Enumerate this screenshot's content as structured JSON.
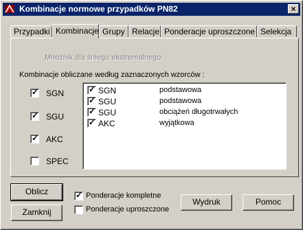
{
  "window": {
    "title": "Kombinacje normowe przypadków PN82",
    "close_label": "×"
  },
  "tabs": [
    {
      "label": "Przypadki"
    },
    {
      "label": "Kombinacje"
    },
    {
      "label": "Grupy"
    },
    {
      "label": "Relacje"
    },
    {
      "label": "Ponderacje uproszczone"
    },
    {
      "label": "Selekcja"
    }
  ],
  "panel": {
    "snow_label": "Mnożnik dla śniegu ekstremalnego:",
    "group_label": "Kombinacje obliczane według zaznaczonych wzorców :",
    "patterns": [
      {
        "label": "SGN",
        "checked": "✓"
      },
      {
        "label": "SGU",
        "checked": "✓"
      },
      {
        "label": "AKC",
        "checked": "✓"
      },
      {
        "label": "SPEC",
        "checked": ""
      }
    ],
    "list": [
      {
        "name": "SGN",
        "desc": "podstawowa",
        "checked": "✓"
      },
      {
        "name": "SGU",
        "desc": "podstawowa",
        "checked": "✓"
      },
      {
        "name": "SGU",
        "desc": "obciążeń długotrwałych",
        "checked": "✓"
      },
      {
        "name": "AKC",
        "desc": "wyjątkowa",
        "checked": "✓"
      }
    ]
  },
  "bottom": {
    "calc_label": "Oblicz",
    "close_label": "Zamknij",
    "ponder_full": {
      "label": "Ponderacje kompletne",
      "checked": "✓"
    },
    "ponder_simple": {
      "label": "Ponderacje uproszczone",
      "checked": ""
    },
    "print_label": "Wydruk",
    "help_label": "Pomoc"
  }
}
